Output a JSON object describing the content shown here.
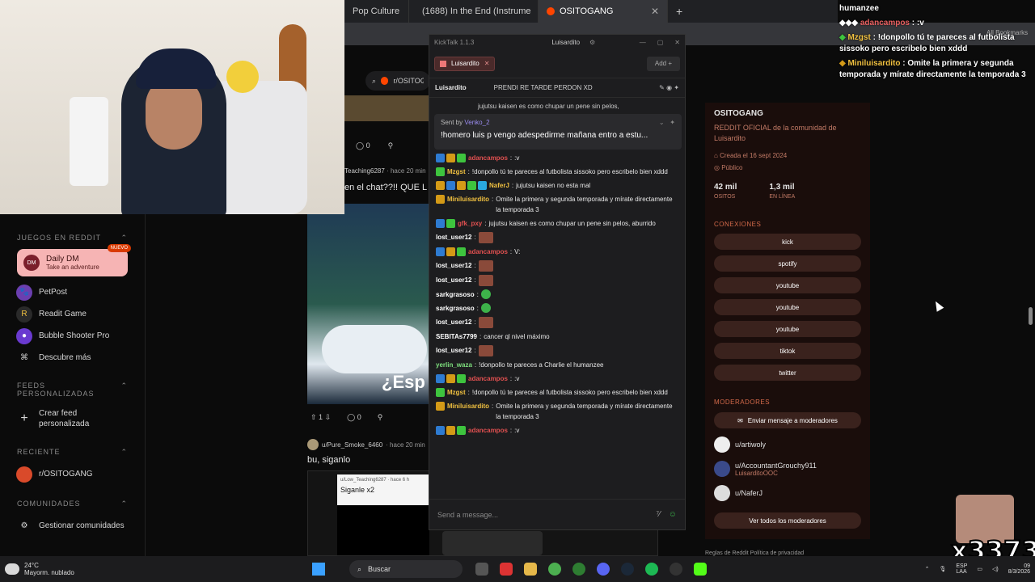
{
  "browser": {
    "tabs": [
      {
        "label": "Pop Culture",
        "active": false
      },
      {
        "label": "(1688) In the End (Instrume",
        "active": false
      },
      {
        "label": "OSITOGANG",
        "active": true
      }
    ],
    "new_tab": "+",
    "bookmarks": "All Bookmarks",
    "search_sub": "r/OSITOG"
  },
  "sidebar": {
    "games_header": "JUEGOS EN REDDIT",
    "daily_dm": {
      "title": "Daily DM",
      "sub": "Take an adventure",
      "badge": "NUEVO"
    },
    "games": [
      {
        "label": "PetPost"
      },
      {
        "label": "Readit Game"
      },
      {
        "label": "Bubble Shooter Pro"
      },
      {
        "label": "Descubre más"
      }
    ],
    "feeds_header": "FEEDS PERSONALIZADAS",
    "create_feed": "Crear feed personalizada",
    "recent_header": "RECIENTE",
    "recent_item": "r/OSITOGANG",
    "communities_header": "COMUNIDADES",
    "manage": "Gestionar comunidades",
    "partial": "r/OSITOGANG"
  },
  "feed": {
    "post1_votes": "0",
    "post1_author": "Teaching6287",
    "post1_age": "· hace 20 min",
    "post1_title": "en el chat??!! QUE L",
    "meme_text": "¿Esp",
    "post2_score": "1",
    "post2_comments": "0",
    "post3_author": "u/Pure_Smoke_6460",
    "post3_age": "· hace 20 min",
    "post3_title": "bu, siganlo",
    "embed_author": "u/Low_Teaching6287",
    "embed_age": "· hace 6 h",
    "embed_title": "Siganle x2"
  },
  "kicktalk": {
    "app_title": "KickTalk 1.1.3",
    "user": "Luisardito",
    "tab": "Luisardito",
    "add": "Add",
    "header_user": "Luisardito",
    "header_msg": "PRENDI RE TARDE PERDON XD",
    "partial_line": "jujutsu kaisen es como chupar un pene sin pelos,",
    "pinned": {
      "sent_by_label": "Sent by",
      "sent_by": "Venko_2",
      "text": "!homero luis p vengo adespedirme mañana entro a estu..."
    },
    "messages": [
      {
        "user": "adancampos",
        "color": "#e05050",
        "badges": [
          "b-blue",
          "b-gold",
          "b-green"
        ],
        "text": ":v"
      },
      {
        "user": "Mzgst",
        "color": "#f0c040",
        "badges": [
          "b-green"
        ],
        "text": "!donpollo tú te pareces al futbolista sissoko pero escribelo bien xddd"
      },
      {
        "user": "NaferJ",
        "color": "#f0c040",
        "badges": [
          "b-gold",
          "b-blue",
          "b-gold",
          "b-green",
          "b-cyan"
        ],
        "text": "jujutsu kaisen no esta mal"
      },
      {
        "user": "Miniluisardito",
        "color": "#f0c040",
        "badges": [
          "b-gold"
        ],
        "text": "Omite la primera y segunda temporada y mírate directamente la temporada 3"
      },
      {
        "user": "gfk_pxy",
        "color": "#e05050",
        "badges": [
          "b-blue",
          "b-green"
        ],
        "text": "jujutsu kaisen es como chupar un pene sin pelos, aburrido"
      },
      {
        "user": "lost_user12",
        "color": "#ffffff",
        "badges": [],
        "text": "",
        "emote": "r"
      },
      {
        "user": "adancampos",
        "color": "#e05050",
        "badges": [
          "b-blue",
          "b-gold",
          "b-green"
        ],
        "text": "V:"
      },
      {
        "user": "lost_user12",
        "color": "#ffffff",
        "badges": [],
        "text": "",
        "emote": "r"
      },
      {
        "user": "lost_user12",
        "color": "#ffffff",
        "badges": [],
        "text": "",
        "emote": "r"
      },
      {
        "user": "sarkgrasoso",
        "color": "#ffffff",
        "badges": [],
        "text": "",
        "emote": "g"
      },
      {
        "user": "sarkgrasoso",
        "color": "#ffffff",
        "badges": [],
        "text": "",
        "emote": "g"
      },
      {
        "user": "lost_user12",
        "color": "#ffffff",
        "badges": [],
        "text": "",
        "emote": "r"
      },
      {
        "user": "SEBITAs7799",
        "color": "#ffffff",
        "badges": [],
        "text": "cancer ql nivel máximo"
      },
      {
        "user": "lost_user12",
        "color": "#ffffff",
        "badges": [],
        "text": "",
        "emote": "r"
      },
      {
        "user": "yerlin_waza",
        "color": "#7ee07e",
        "badges": [],
        "text": "!donpollo te pareces a Charlie el humanzee"
      },
      {
        "user": "adancampos",
        "color": "#e05050",
        "badges": [
          "b-blue",
          "b-gold",
          "b-green"
        ],
        "text": ":v"
      },
      {
        "user": "Mzgst",
        "color": "#f0c040",
        "badges": [
          "b-green"
        ],
        "text": "!donpollo tú te pareces al futbolista sissoko pero escribelo bien xddd"
      },
      {
        "user": "Miniluisardito",
        "color": "#f0c040",
        "badges": [
          "b-gold"
        ],
        "text": "Omite la primera y segunda temporada y mírate directamente la temporada 3"
      },
      {
        "user": "adancampos",
        "color": "#e05050",
        "badges": [
          "b-blue",
          "b-gold",
          "b-green"
        ],
        "text": ":v"
      }
    ],
    "input_placeholder": "Send a message..."
  },
  "community": {
    "name": "OSITOGANG",
    "desc": "REDDIT OFICIAL de la comunidad de Luisardito",
    "created": "Creada el 16 sept 2024",
    "visibility": "Público",
    "members": "42 mil",
    "members_label": "OSITOS",
    "online": "1,3 mil",
    "online_label": "EN LÍNEA",
    "connections_header": "CONEXIONES",
    "connections": [
      "kick",
      "spotify",
      "youtube",
      "youtube",
      "youtube",
      "tiktok",
      "twitter"
    ],
    "mods_header": "MODERADORES",
    "message_mods": "Enviar mensaje a moderadores",
    "mods": [
      {
        "name": "u/artiwoly",
        "sub": ""
      },
      {
        "name": "u/AccountantGrouchy911",
        "sub": "LuisarditoOOC"
      },
      {
        "name": "u/NaferJ",
        "sub": ""
      }
    ],
    "all_mods": "Ver todos los moderadores",
    "footer": "Reglas de Reddit   Política de privacidad"
  },
  "overlay": {
    "top_text": "humanzee",
    "lines": [
      {
        "user": "adancampos",
        "text": ":v"
      },
      {
        "user": "Mzgst",
        "text": "!donpollo tú te pareces al futbolista sissoko pero escribelo bien xddd"
      },
      {
        "user": "Miniluisardito",
        "text": "Omite la primera y segunda temporada y mírate directamente la temporada 3"
      }
    ],
    "counter": "x3373"
  },
  "taskbar": {
    "temp": "24°C",
    "weather": "Mayorm. nublado",
    "search": "Buscar",
    "lang": "ESP",
    "lang2": "LAA",
    "time": "09",
    "date": "8/3/2026"
  }
}
